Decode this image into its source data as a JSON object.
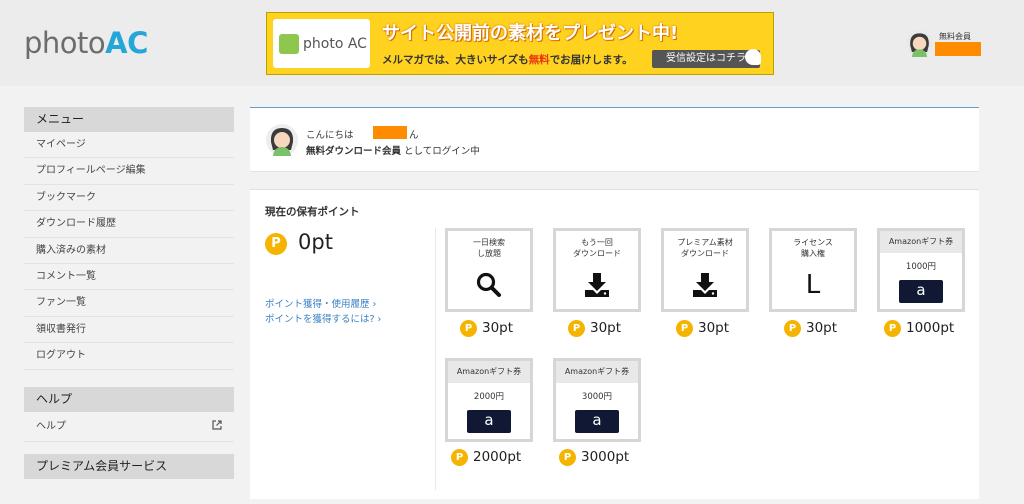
{
  "header": {
    "logo_photo": "photo",
    "logo_ac": "AC",
    "banner": {
      "badge_text": "photo AC",
      "headline": "サイト公開前の素材をプレゼント中!",
      "sub_before": "メルマガでは、大きいサイズも",
      "sub_highlight": "無料",
      "sub_after": "でお届けします。",
      "button": "受信設定はコチラ"
    },
    "user_status": "無料会員"
  },
  "sidebar": {
    "menu_heading": "メニュー",
    "menu_items": [
      "マイページ",
      "プロフィールページ編集",
      "ブックマーク",
      "ダウンロード履歴",
      "購入済みの素材",
      "コメント一覧",
      "ファン一覧",
      "領収書発行",
      "ログアウト"
    ],
    "help_heading": "ヘルプ",
    "help_items": [
      "ヘルプ"
    ],
    "premium_heading": "プレミアム会員サービス"
  },
  "login": {
    "hello_prefix": "こんにちは",
    "san": "ん",
    "member_type": "無料ダウンロード会員",
    "login_suffix": "としてログイン中"
  },
  "points": {
    "title": "現在の保有ポイント",
    "coin_glyph": "P",
    "current": "0pt",
    "links": [
      "ポイント獲得・使用履歴 ›",
      "ポイントを獲得するには? ›"
    ],
    "products": [
      {
        "label": "一日検索\nし放題",
        "icon": "search-icon",
        "price": "30pt"
      },
      {
        "label": "もう一回\nダウンロード",
        "icon": "download-icon",
        "price": "30pt"
      },
      {
        "label": "プレミアム素材\nダウンロード",
        "icon": "download-icon",
        "price": "30pt"
      },
      {
        "label": "ライセンス\n購入権",
        "icon": "letter-L",
        "letter": "L",
        "price": "30pt"
      },
      {
        "label": "Amazonギフト券",
        "amount": "1000円",
        "logo": "a",
        "price": "1000pt"
      },
      {
        "label": "Amazonギフト券",
        "amount": "2000円",
        "logo": "a",
        "price": "2000pt"
      },
      {
        "label": "Amazonギフト券",
        "amount": "3000円",
        "logo": "a",
        "price": "3000pt"
      }
    ]
  },
  "colors": {
    "accent": "#25a6d9",
    "coin": "#f5b400",
    "banner": "#ffd21f",
    "redaction": "#ff8c00",
    "link": "#3a82c4",
    "amazon_dark": "#101834"
  }
}
